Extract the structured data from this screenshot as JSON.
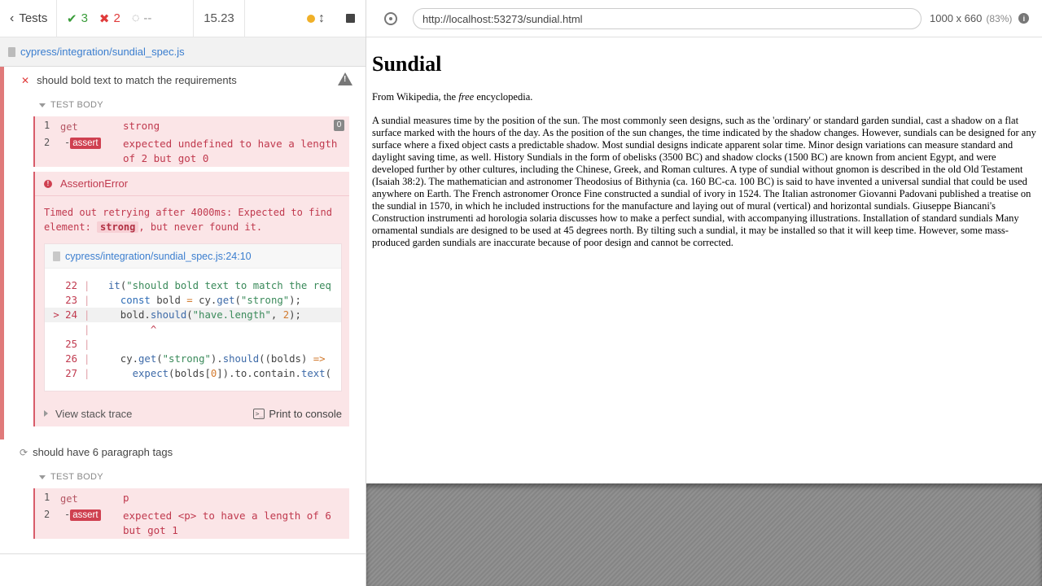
{
  "reporter": {
    "tests_label": "Tests",
    "passed": "3",
    "failed": "2",
    "pending": "--",
    "duration": "15.23",
    "spec_path": "cypress/integration/sundial_spec.js"
  },
  "test1": {
    "title": "should bold text to match the requirements",
    "section": "TEST BODY",
    "commands": [
      {
        "num": "1",
        "name": "get",
        "msg": "strong",
        "badge": "0"
      },
      {
        "num": "2",
        "name": "-assert",
        "msg_line1": "expected undefined to have a length",
        "msg_line2": "of 2 but got 0"
      }
    ],
    "error": {
      "title": "AssertionError",
      "line1": "Timed out retrying after 4000ms: Expected to find",
      "line2_pre": "element: ",
      "line2_code": "strong",
      "line2_post": ", but never found it.",
      "frame_path": "cypress/integration/sundial_spec.js:24:10",
      "code_lines": [
        {
          "ln": "22",
          "pipe": "|",
          "code": "it(\"should bold text to match the req"
        },
        {
          "ln": "23",
          "pipe": "|",
          "code": "  const bold = cy.get(\"strong\");"
        },
        {
          "ln": "> 24",
          "pipe": "|",
          "code": "  bold.should(\"have.length\", 2);"
        },
        {
          "ln": "",
          "pipe": "|",
          "code": "       ^"
        },
        {
          "ln": "25",
          "pipe": "|",
          "code": ""
        },
        {
          "ln": "26",
          "pipe": "|",
          "code": "  cy.get(\"strong\").should((bolds) =>"
        },
        {
          "ln": "27",
          "pipe": "|",
          "code": "    expect(bolds[0]).to.contain.text("
        }
      ],
      "stack_trace_label": "View stack trace",
      "print_console_label": "Print to console"
    }
  },
  "test2": {
    "title": "should have 6 paragraph tags",
    "section": "TEST BODY",
    "commands": [
      {
        "num": "1",
        "name": "get",
        "msg": "p"
      },
      {
        "num": "2",
        "name": "-assert",
        "msg_line1": "expected <p> to have a length of 6",
        "msg_line2": "but got 1"
      }
    ]
  },
  "aut": {
    "url": "http://localhost:53273/sundial.html",
    "viewport": "1000 x 660",
    "zoom": "(83%)",
    "page": {
      "title": "Sundial",
      "intro_pre": "From Wikipedia, the ",
      "intro_em": "free",
      "intro_post": " encyclopedia.",
      "body": "A sundial measures time by the position of the sun. The most commonly seen designs, such as the 'ordinary' or standard garden sundial, cast a shadow on a flat surface marked with the hours of the day. As the position of the sun changes, the time indicated by the shadow changes. However, sundials can be designed for any surface where a fixed object casts a predictable shadow. Most sundial designs indicate apparent solar time. Minor design variations can measure standard and daylight saving time, as well. History Sundials in the form of obelisks (3500 BC) and shadow clocks (1500 BC) are known from ancient Egypt, and were developed further by other cultures, including the Chinese, Greek, and Roman cultures. A type of sundial without gnomon is described in the old Old Testament (Isaiah 38:2). The mathematician and astronomer Theodosius of Bithynia (ca. 160 BC-ca. 100 BC) is said to have invented a universal sundial that could be used anywhere on Earth. The French astronomer Oronce Fine constructed a sundial of ivory in 1524. The Italian astronomer Giovanni Padovani published a treatise on the sundial in 1570, in which he included instructions for the manufacture and laying out of mural (vertical) and horizontal sundials. Giuseppe Biancani's Construction instrumenti ad horologia solaria discusses how to make a perfect sundial, with accompanying illustrations. Installation of standard sundials Many ornamental sundials are designed to be used at 45 degrees north. By tilting such a sundial, it may be installed so that it will keep time. However, some mass-produced garden sundials are inaccurate because of poor design and cannot be corrected."
    }
  },
  "colors": {
    "pass": "#3a9c3a",
    "fail": "#e03b3b",
    "error_bg": "#fbe5e7",
    "link": "#3b7ecf"
  },
  "icons": {
    "back": "chevron-left-icon",
    "pass": "check-icon",
    "fail": "x-icon",
    "pending": "circle-notch-icon",
    "running": "orange-dot-icon",
    "scroll": "up-down-arrows-icon",
    "stop": "stop-square-icon",
    "file": "file-icon",
    "warning": "warning-triangle-icon",
    "retry": "refresh-icon",
    "selector": "crosshair-icon",
    "info": "info-icon"
  }
}
